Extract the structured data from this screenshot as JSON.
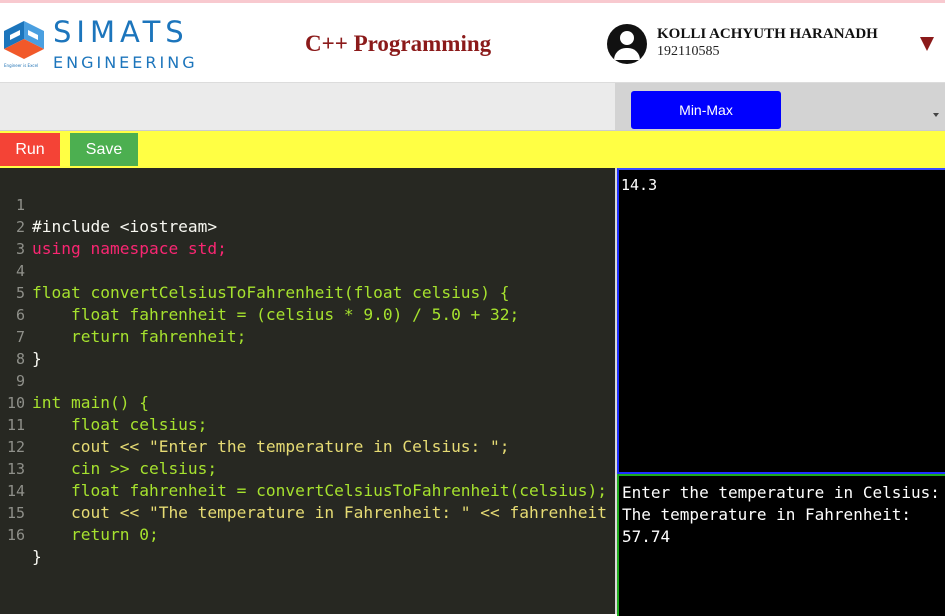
{
  "header": {
    "logo_line1": "SIMATS",
    "logo_line2": "ENGINEERING",
    "logo_tagline": "Engineer is Excel",
    "app_title": "C++ Programming",
    "user_name": "KOLLI ACHYUTH HARANADH",
    "user_id": "192110585"
  },
  "toolbar": {
    "problem_button_label": "Min-Max"
  },
  "actions": {
    "run_label": "Run",
    "save_label": "Save"
  },
  "editor": {
    "line_numbers": [
      "1",
      "2",
      "3",
      "4",
      "5",
      "6",
      "7",
      "8",
      "9",
      "10",
      "11",
      "12",
      "13",
      "14",
      "15",
      "16"
    ],
    "lines": [
      "#include <iostream>",
      "using namespace std;",
      "",
      "float convertCelsiusToFahrenheit(float celsius) {",
      "    float fahrenheit = (celsius * 9.0) / 5.0 + 32;",
      "    return fahrenheit;",
      "}",
      "",
      "int main() {",
      "    float celsius;",
      "    cout << \"Enter the temperature in Celsius: \";",
      "    cin >> celsius;",
      "    float fahrenheit = convertCelsiusToFahrenheit(celsius);",
      "    cout << \"The temperature in Fahrenheit: \" << fahrenheit << endl;",
      "    return 0;",
      "}"
    ]
  },
  "input_pane": {
    "value": "14.3"
  },
  "output_pane": {
    "text": "Enter the temperature in Celsius: The temperature in Fahrenheit: 57.74"
  },
  "colors": {
    "run": "#f44336",
    "save": "#4caf50",
    "action_bar": "#ffff44",
    "problem_button": "#0000ff",
    "title": "#8b1a1a",
    "editor_bg": "#272822",
    "input_border": "#1f2fff",
    "output_border": "#1eaa1e"
  }
}
